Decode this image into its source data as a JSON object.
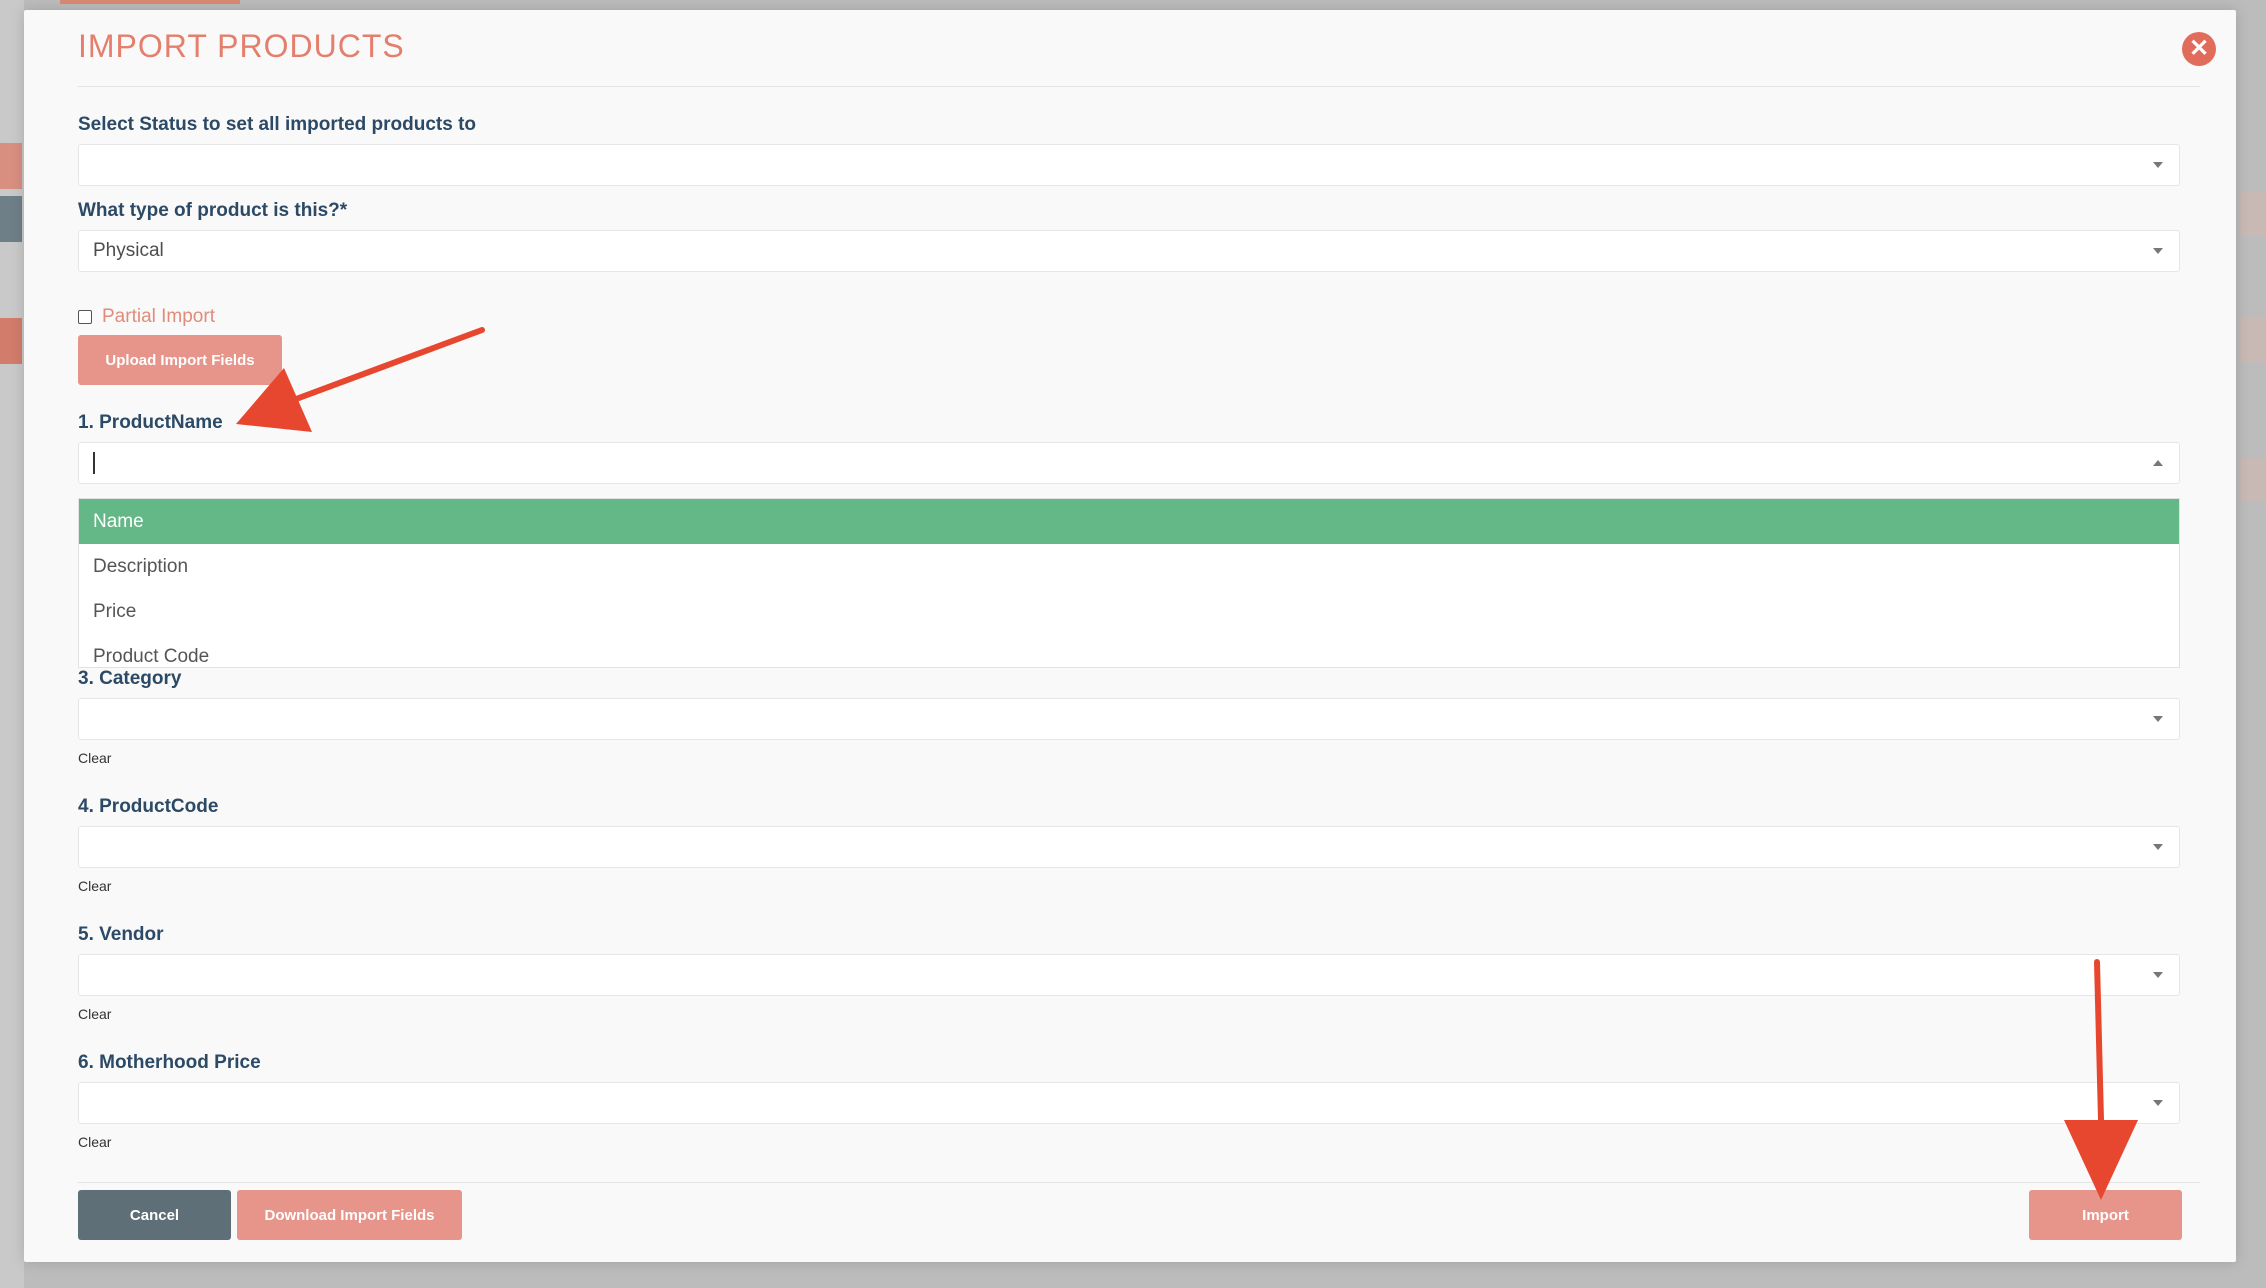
{
  "modal": {
    "title": "IMPORT PRODUCTS",
    "close_symbol": "✕"
  },
  "status_field": {
    "label": "Select Status to set all imported products to",
    "value": ""
  },
  "type_field": {
    "label": "What type of product is this?*",
    "value": "Physical"
  },
  "partial_import": {
    "label": "Partial Import",
    "checked": false
  },
  "upload_button": "Upload Import Fields",
  "fields": [
    {
      "label": "1. ProductName",
      "value": ""
    },
    {
      "label": "3. Category",
      "value": "",
      "clear": "Clear"
    },
    {
      "label": "4. ProductCode",
      "value": "",
      "clear": "Clear"
    },
    {
      "label": "5. Vendor",
      "value": "",
      "clear": "Clear"
    },
    {
      "label": "6. Motherhood Price",
      "value": "",
      "clear": "Clear"
    }
  ],
  "dropdown_options": [
    "Name",
    "Description",
    "Price",
    "Product Code"
  ],
  "footer": {
    "cancel": "Cancel",
    "download": "Download Import Fields",
    "import": "Import"
  },
  "colors": {
    "accent": "#e47f6d",
    "selected_option": "#64b787",
    "annotation_arrow": "#e8472f"
  }
}
